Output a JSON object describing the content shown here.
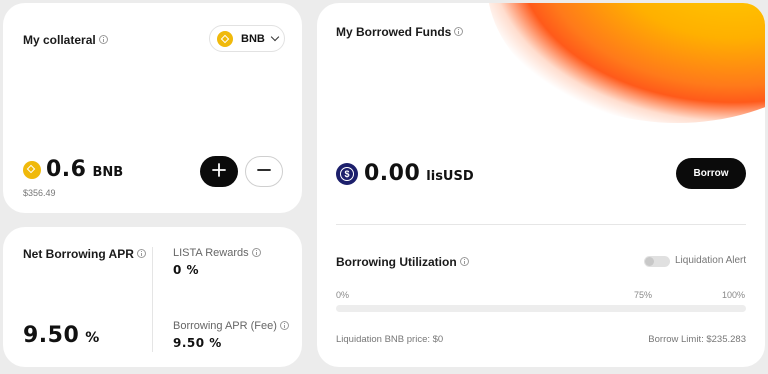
{
  "collateral": {
    "title": "My collateral",
    "token_selector": "BNB",
    "amount": "0.6",
    "unit": "BNB",
    "usd_value": "$356.49"
  },
  "apr": {
    "net_title": "Net Borrowing APR",
    "net_value": "9.50",
    "net_unit": "%",
    "rewards_label": "LISTA Rewards",
    "rewards_value": "0 %",
    "fee_label": "Borrowing APR (Fee)",
    "fee_value": "9.50 %"
  },
  "borrowed": {
    "title": "My Borrowed Funds",
    "amount": "0.00",
    "unit": "lisUSD",
    "borrow_button": "Borrow"
  },
  "utilization": {
    "title": "Borrowing Utilization",
    "toggle_label": "Liquidation Alert",
    "toggle_on": false,
    "tick_0": "0%",
    "tick_75": "75%",
    "tick_100": "100%",
    "utilization_value": 0,
    "liquidation_price": "Liquidation BNB price: $0",
    "borrow_limit": "Borrow Limit: $235.283"
  },
  "icons": {
    "info": "info-icon",
    "token_bnb": "bnb-icon",
    "token_lisusd": "lisusd-icon",
    "plus": "plus-icon",
    "minus": "minus-icon",
    "dropdown": "chevron-down-icon"
  }
}
